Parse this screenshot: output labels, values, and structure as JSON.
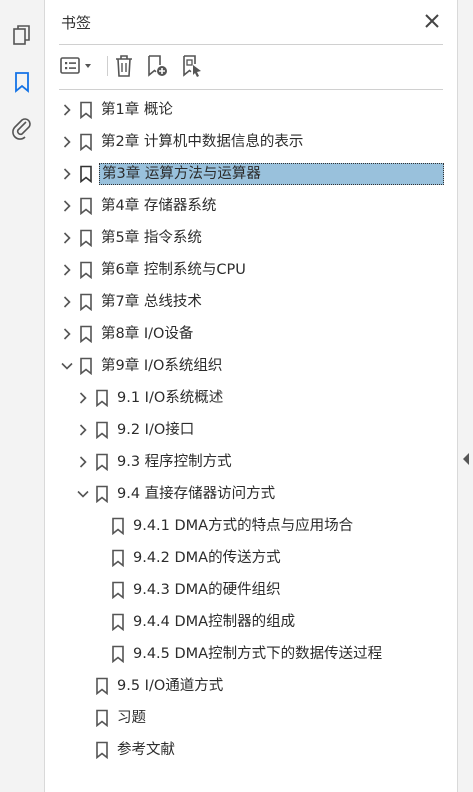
{
  "panel": {
    "title": "书签"
  },
  "colors": {
    "accent": "#1473e6",
    "selection": "#99c1dc",
    "icon": "#555555"
  },
  "rail": {
    "icons": [
      "pages-icon",
      "bookmark-icon",
      "attachment-icon"
    ]
  },
  "toolbar": {
    "icons": [
      "options-icon",
      "delete-bookmark-icon",
      "new-bookmark-icon",
      "new-bookmark-from-structure-icon"
    ]
  },
  "bookmarks": [
    {
      "label": "第1章 概论",
      "level": 0,
      "chevron": "right"
    },
    {
      "label": "第2章 计算机中数据信息的表示",
      "level": 0,
      "chevron": "right"
    },
    {
      "label": "第3章 运算方法与运算器",
      "level": 0,
      "chevron": "right",
      "selected": true
    },
    {
      "label": "第4章 存储器系统",
      "level": 0,
      "chevron": "right"
    },
    {
      "label": "第5章 指令系统",
      "level": 0,
      "chevron": "right"
    },
    {
      "label": "第6章 控制系统与CPU",
      "level": 0,
      "chevron": "right"
    },
    {
      "label": "第7章 总线技术",
      "level": 0,
      "chevron": "right"
    },
    {
      "label": "第8章 I/O设备",
      "level": 0,
      "chevron": "right"
    },
    {
      "label": "第9章 I/O系统组织",
      "level": 0,
      "chevron": "down"
    },
    {
      "label": "9.1 I/O系统概述",
      "level": 1,
      "chevron": "right"
    },
    {
      "label": "9.2 I/O接口",
      "level": 1,
      "chevron": "right"
    },
    {
      "label": "9.3 程序控制方式",
      "level": 1,
      "chevron": "right"
    },
    {
      "label": "9.4 直接存储器访问方式",
      "level": 1,
      "chevron": "down"
    },
    {
      "label": "9.4.1 DMA方式的特点与应用场合",
      "level": 2,
      "chevron": "none"
    },
    {
      "label": "9.4.2 DMA的传送方式",
      "level": 2,
      "chevron": "none"
    },
    {
      "label": "9.4.3 DMA的硬件组织",
      "level": 2,
      "chevron": "none"
    },
    {
      "label": "9.4.4 DMA控制器的组成",
      "level": 2,
      "chevron": "none"
    },
    {
      "label": "9.4.5 DMA控制方式下的数据传送过程",
      "level": 2,
      "chevron": "none"
    },
    {
      "label": "9.5 I/O通道方式",
      "level": 1,
      "chevron": "none"
    },
    {
      "label": "习题",
      "level": 1,
      "chevron": "none"
    },
    {
      "label": "参考文献",
      "level": 1,
      "chevron": "none"
    }
  ]
}
